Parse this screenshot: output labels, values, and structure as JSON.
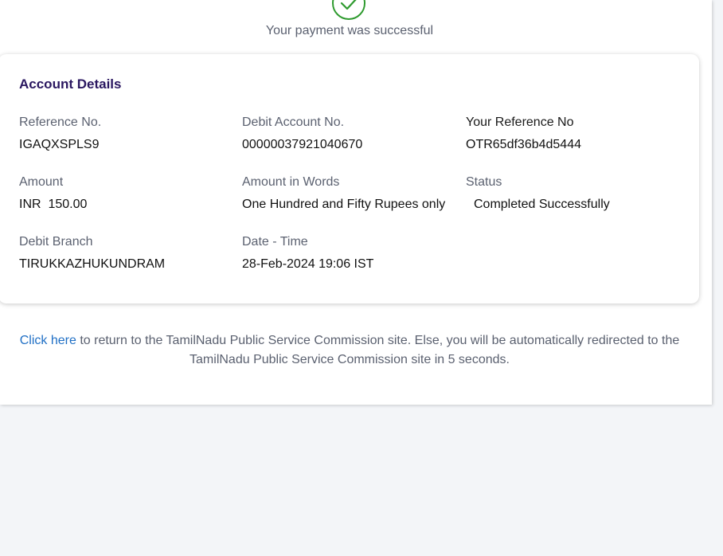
{
  "header": {
    "success_message": "Your payment was successful",
    "success_icon": "check-circle-icon",
    "success_color": "#2e9a2e"
  },
  "account_details": {
    "title": "Account Details",
    "fields": [
      {
        "label": "Reference No.",
        "value": "IGAQXSPLS9"
      },
      {
        "label": "Debit Account No.",
        "value": "00000037921040670"
      },
      {
        "label": "Your Reference No",
        "value": "OTR65df36b4d5444"
      },
      {
        "label": "Amount",
        "value": "INR  150.00"
      },
      {
        "label": "Amount in Words",
        "value": "One Hundred and Fifty Rupees only"
      },
      {
        "label": "Status",
        "value": "Completed Successfully"
      },
      {
        "label": "Debit Branch",
        "value": "TIRUKKAZHUKUNDRAM"
      },
      {
        "label": "Date - Time",
        "value": "28-Feb-2024 19:06 IST"
      }
    ]
  },
  "redirect": {
    "link_text": "Click here",
    "message": " to return to the TamilNadu Public Service Commission site. Else, you will be automatically redirected to the TamilNadu Public Service Commission site in 5 seconds.",
    "link_color": "#1f6fc5"
  },
  "colors": {
    "title": "#2a1760",
    "label": "#5b6170",
    "page_background": "#f3f5f8"
  }
}
